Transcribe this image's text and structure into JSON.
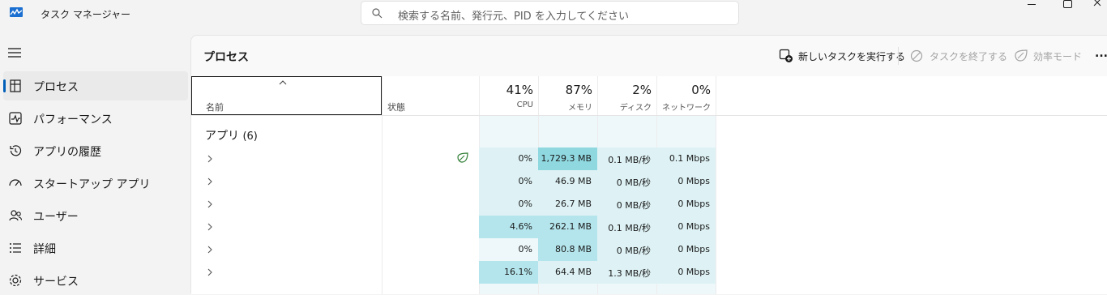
{
  "app": {
    "title": "タスク マネージャー"
  },
  "search": {
    "placeholder": "検索する名前、発行元、PID を入力してください"
  },
  "sidebar": {
    "items": [
      {
        "label": "プロセス",
        "active": true,
        "icon": "processes-icon"
      },
      {
        "label": "パフォーマンス",
        "active": false,
        "icon": "performance-icon"
      },
      {
        "label": "アプリの履歴",
        "active": false,
        "icon": "app-history-icon"
      },
      {
        "label": "スタートアップ アプリ",
        "active": false,
        "icon": "startup-apps-icon"
      },
      {
        "label": "ユーザー",
        "active": false,
        "icon": "users-icon"
      },
      {
        "label": "詳細",
        "active": false,
        "icon": "details-icon"
      },
      {
        "label": "サービス",
        "active": false,
        "icon": "services-icon"
      }
    ]
  },
  "page": {
    "title": "プロセス"
  },
  "toolbar": {
    "new_task_label": "新しいタスクを実行する",
    "end_task_label": "タスクを終了する",
    "efficiency_label": "効率モード",
    "more": "..."
  },
  "table": {
    "headers": {
      "name": "名前",
      "status": "状態",
      "cpu": {
        "percent": "41%",
        "label": "CPU"
      },
      "memory": {
        "percent": "87%",
        "label": "メモリ"
      },
      "disk": {
        "percent": "2%",
        "label": "ディスク"
      },
      "network": {
        "percent": "0%",
        "label": "ネットワーク"
      }
    },
    "group": {
      "label": "アプリ",
      "count": "(6)"
    },
    "rows": [
      {
        "name": "",
        "efficiency_icon": true,
        "cpu": "0%",
        "memory": "1,729.3 MB",
        "disk": "0.1 MB/秒",
        "network": "0.1 Mbps"
      },
      {
        "name": "",
        "efficiency_icon": false,
        "cpu": "0%",
        "memory": "46.9 MB",
        "disk": "0 MB/秒",
        "network": "0 Mbps"
      },
      {
        "name": "",
        "efficiency_icon": false,
        "cpu": "0%",
        "memory": "26.7 MB",
        "disk": "0 MB/秒",
        "network": "0 Mbps"
      },
      {
        "name": "",
        "efficiency_icon": false,
        "cpu": "4.6%",
        "memory": "262.1 MB",
        "disk": "0.1 MB/秒",
        "network": "0 Mbps"
      },
      {
        "name": "",
        "efficiency_icon": false,
        "cpu": "0%",
        "memory": "80.8 MB",
        "disk": "0 MB/秒",
        "network": "0 Mbps"
      },
      {
        "name": "",
        "efficiency_icon": false,
        "cpu": "16.1%",
        "memory": "64.4 MB",
        "disk": "1.3 MB/秒",
        "network": "0 Mbps"
      }
    ]
  },
  "colors": {
    "accent": "#005fb8",
    "heat_low": "#def2f5",
    "heat_mid": "#b4e5ec",
    "heat_high": "#8fd8e0",
    "leaf": "#2e7d32"
  }
}
